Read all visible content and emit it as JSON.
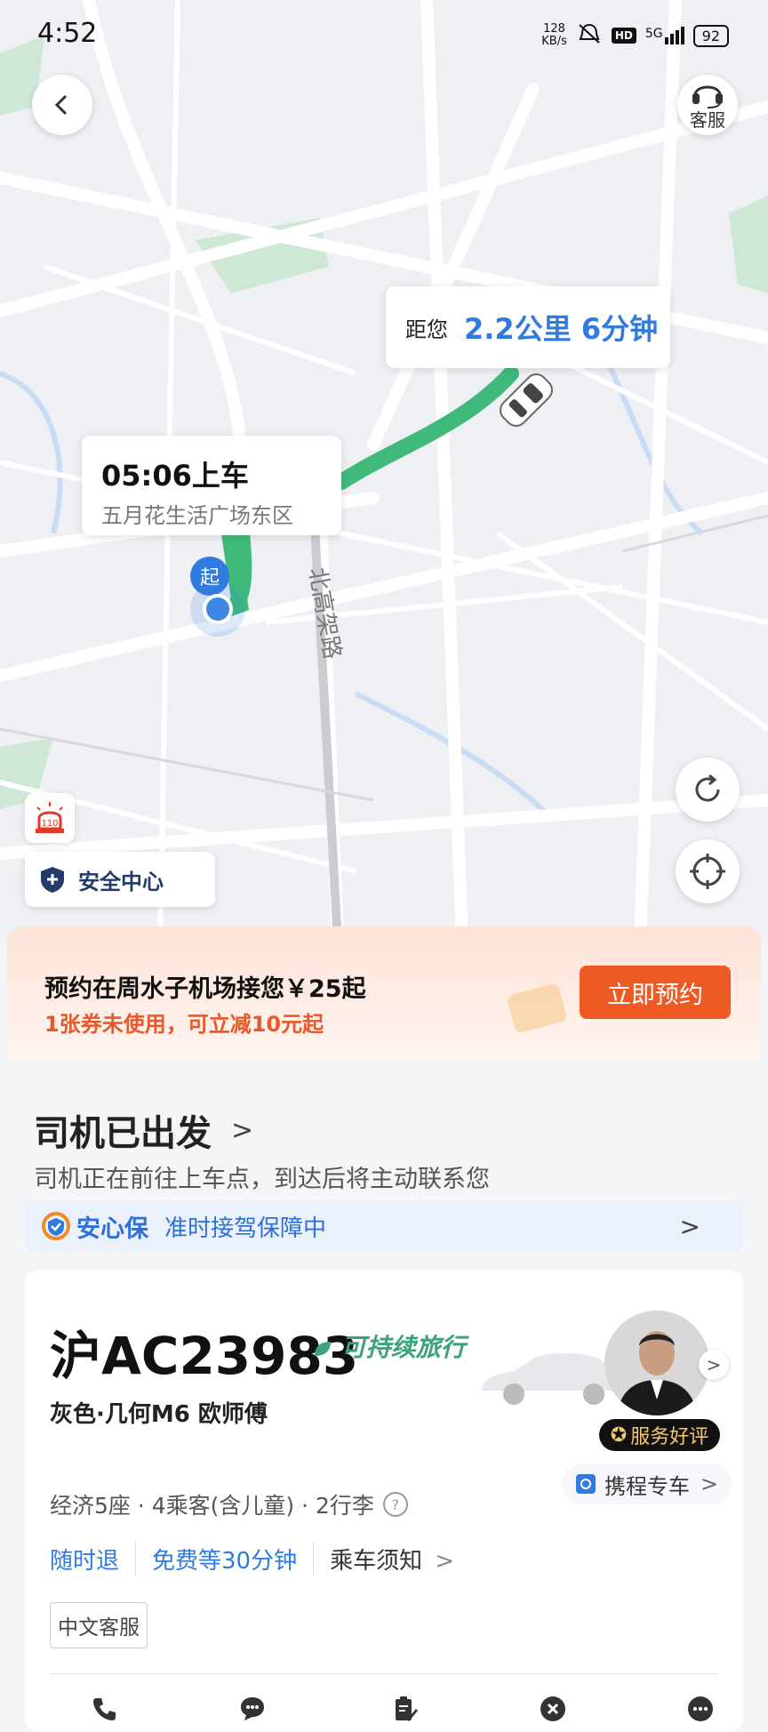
{
  "status_bar": {
    "time": "4:52",
    "net_speed_value": "128",
    "net_speed_unit": "KB/s",
    "hd": "HD",
    "network": "5G",
    "battery": "92"
  },
  "header": {
    "service_label": "客服"
  },
  "map": {
    "distance_prefix": "距您",
    "distance_value": "2.2公里 6分钟",
    "pickup_time": "05:06上车",
    "pickup_place": "五月花生活广场东区",
    "pin_label": "起",
    "road_label": "北高架路",
    "alarm_label": "110",
    "safety_label": "安全中心"
  },
  "promo": {
    "line1": "预约在周水子机场接您￥25起",
    "line2": "1张券未使用，可立减10元起",
    "button": "立即预约"
  },
  "trip": {
    "status_title": "司机已出发",
    "status_sub": "司机正在前往上车点，到达后将主动联系您",
    "insurance_brand": "安心保",
    "insurance_text": "准时接驾保障中"
  },
  "driver": {
    "plate": "沪AC23983",
    "eco_tag": "可持续旅行",
    "car_desc": "灰色·几何M6   欧师傅",
    "badge": "服务好评",
    "provider": "携程专车",
    "specs": "经济5座 · 4乘客(含儿童) · 2行李",
    "policy_1": "随时退",
    "policy_2": "免费等30分钟",
    "policy_3": "乘车须知",
    "lang_tag": "中文客服"
  },
  "colors": {
    "accent_blue": "#2f7be0",
    "route_green": "#3fba7a",
    "promo_orange": "#ee5a24"
  }
}
